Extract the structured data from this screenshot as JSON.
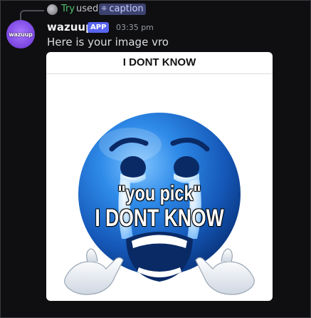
{
  "reply": {
    "user": "Try",
    "action": "used",
    "command": "caption",
    "command_icon": "slash-command-icon"
  },
  "message": {
    "avatar_text": "wazuup",
    "username": "wazuup",
    "badge": "APP",
    "timestamp": "03:35 pm",
    "text": "Here is your image vro"
  },
  "attachment": {
    "caption_title": "I DONT KNOW",
    "meme_line1": "\"you pick\"",
    "meme_line2": "I DONT KNOW",
    "emoji": "crying-blue-emoji"
  },
  "colors": {
    "background": "#0f0f11",
    "app_badge": "#5865f2",
    "reply_user": "#4fc36b",
    "command_chip": "#3c4270",
    "emoji_blue": "#1e6fd6"
  }
}
